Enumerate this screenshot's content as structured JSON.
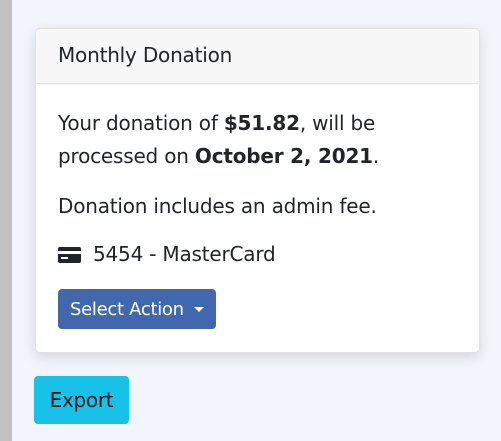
{
  "card": {
    "title": "Monthly Donation",
    "donation": {
      "prefix": "Your donation of ",
      "amount": "$51.82",
      "middle": ", will be processed on ",
      "date": "October 2, 2021",
      "suffix": "."
    },
    "fee_note": "Donation includes an admin fee.",
    "payment": {
      "icon": "credit-card-icon",
      "text": "5454 - MasterCard"
    },
    "action_label": "Select Action"
  },
  "export_label": "Export",
  "colors": {
    "page_bg": "#f3f5fc",
    "left_bar": "#c2c2c2",
    "select_action_bg": "#4168ad",
    "export_bg": "#17c1e8"
  }
}
